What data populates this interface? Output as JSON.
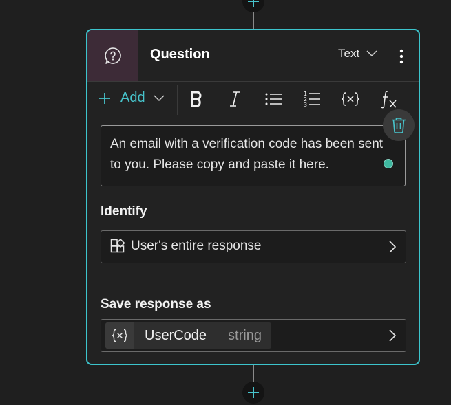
{
  "card": {
    "title": "Question",
    "type_select": {
      "value": "Text"
    },
    "icons": {
      "header": "question-circle-icon",
      "more": "more-vertical-icon"
    }
  },
  "toolbar": {
    "add_label": "Add",
    "buttons": [
      {
        "name": "bold",
        "icon": "bold-icon"
      },
      {
        "name": "italic",
        "icon": "italic-icon"
      },
      {
        "name": "bullet-list",
        "icon": "bullet-list-icon"
      },
      {
        "name": "numbered-list",
        "icon": "numbered-list-icon"
      },
      {
        "name": "insert-variable",
        "icon": "variable-icon"
      },
      {
        "name": "insert-formula",
        "icon": "formula-icon"
      }
    ]
  },
  "message": {
    "text": "An email with a verification code has been sent to you. Please copy and paste it here."
  },
  "identify": {
    "label": "Identify",
    "value": "User's entire response",
    "icon": "entity-shapes-icon"
  },
  "save_response": {
    "label": "Save response as",
    "variable_name": "UserCode",
    "variable_type": "string",
    "icon": "variable-icon"
  },
  "colors": {
    "accent": "#3cc4cc",
    "header_icon_bg": "#3d2b37",
    "status_dot": "#3fb8a0"
  }
}
